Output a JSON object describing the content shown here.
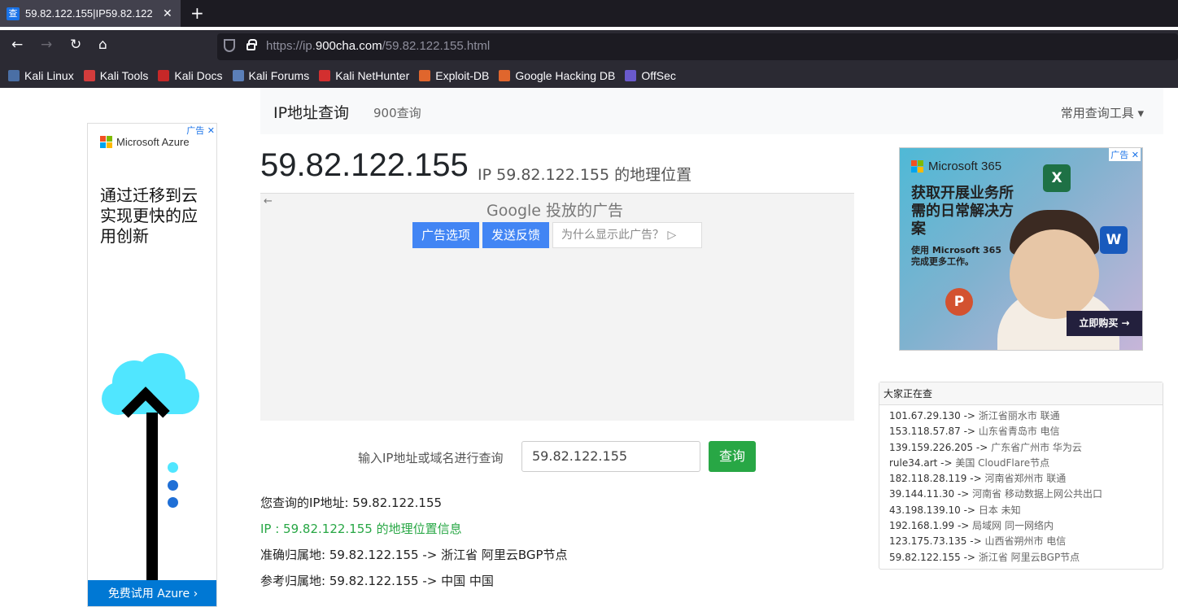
{
  "browser": {
    "tab_title": "59.82.122.155|IP59.82.122",
    "tab_favicon": "查",
    "tab_close": "✕",
    "new_tab": "+",
    "url_prefix": "https://ip.",
    "url_domain": "900cha.com",
    "url_path": "/59.82.122.155.html",
    "bookmarks": [
      {
        "label": "Kali Linux",
        "color": "#4a6fa5"
      },
      {
        "label": "Kali Tools",
        "color": "#d33c3c"
      },
      {
        "label": "Kali Docs",
        "color": "#c62828"
      },
      {
        "label": "Kali Forums",
        "color": "#5b7fb8"
      },
      {
        "label": "Kali NetHunter",
        "color": "#d32f2f"
      },
      {
        "label": "Exploit-DB",
        "color": "#e0662d"
      },
      {
        "label": "Google Hacking DB",
        "color": "#e0662d"
      },
      {
        "label": "OffSec",
        "color": "#6a5acd"
      }
    ]
  },
  "left_ad": {
    "ad_tag": "广告 ✕",
    "brand": "Microsoft Azure",
    "headline": "通过迁移到云实现更快的应用创新",
    "cta": "免费试用 Azure ›"
  },
  "header": {
    "brand": "IP地址查询",
    "sub": "900查询",
    "tools": "常用查询工具 ▾"
  },
  "title": {
    "ip": "59.82.122.155",
    "subtitle": "IP 59.82.122.155 的地理位置"
  },
  "google_ad": {
    "back": "←",
    "label": "Google 投放的广告",
    "options": "广告选项",
    "feedback": "发送反馈",
    "why": "为什么显示此广告？ ▷"
  },
  "query": {
    "label": "输入IP地址或域名进行查询",
    "value": "59.82.122.155",
    "button": "查询"
  },
  "info": {
    "line1": "您查询的IP地址: 59.82.122.155",
    "line2": "IP : 59.82.122.155 的地理位置信息",
    "line3": "准确归属地: 59.82.122.155 -> 浙江省 阿里云BGP节点",
    "line4": "参考归属地: 59.82.122.155 -> 中国 中国"
  },
  "right_ad": {
    "ad_tag": "广告 ✕",
    "brand": "Microsoft 365",
    "headline": "获取开展业务所需的日常解决方案",
    "sub": "使用 Microsoft 365 完成更多工作。",
    "buy": "立即购买 →",
    "apps": [
      "X",
      "W",
      "P"
    ]
  },
  "recent": {
    "title": "大家正在查",
    "items": [
      {
        "ip": "101.67.29.130 -> ",
        "loc": "浙江省丽水市 联通"
      },
      {
        "ip": "153.118.57.87 -> ",
        "loc": "山东省青岛市 电信"
      },
      {
        "ip": "139.159.226.205 -> ",
        "loc": "广东省广州市 华为云"
      },
      {
        "ip": "rule34.art -> ",
        "loc": "美国 CloudFlare节点"
      },
      {
        "ip": "182.118.28.119 -> ",
        "loc": "河南省郑州市 联通"
      },
      {
        "ip": "39.144.11.30 -> ",
        "loc": "河南省 移动数据上网公共出口"
      },
      {
        "ip": "43.198.139.10 -> ",
        "loc": "日本 未知"
      },
      {
        "ip": "192.168.1.99 -> ",
        "loc": "局域网 同一网络内"
      },
      {
        "ip": "123.175.73.135 -> ",
        "loc": "山西省朔州市 电信"
      },
      {
        "ip": "59.82.122.155 -> ",
        "loc": "浙江省 阿里云BGP节点"
      }
    ]
  }
}
